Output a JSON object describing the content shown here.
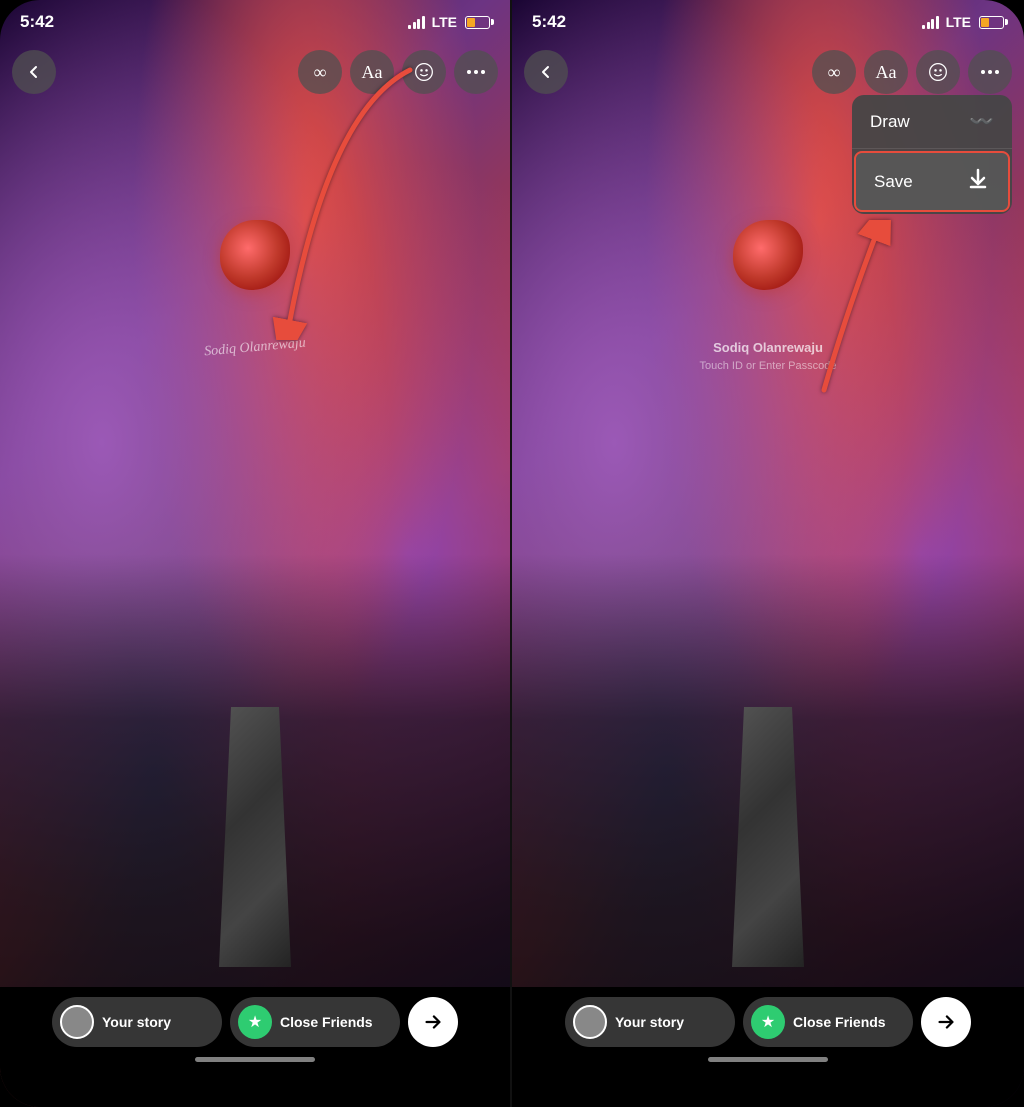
{
  "left_screen": {
    "time": "5:42",
    "lte": "LTE",
    "toolbar": {
      "back_label": "‹",
      "infinity_label": "∞",
      "text_label": "Aa",
      "sticker_label": "☺",
      "more_label": "•••"
    },
    "watermark": "Sodiq Olanrewaju",
    "bottom": {
      "your_story_label": "Your story",
      "close_friends_label": "Close Friends",
      "send_icon": "→"
    }
  },
  "right_screen": {
    "time": "5:42",
    "lte": "LTE",
    "toolbar": {
      "back_label": "‹",
      "infinity_label": "∞",
      "text_label": "Aa",
      "sticker_label": "☺",
      "more_label": "•••"
    },
    "watermark": "Sodiq Olanrewaju",
    "watermark_sub": "Touch ID or Enter Passcode",
    "dropdown": {
      "draw_label": "Draw",
      "draw_icon": "〰",
      "save_label": "Save",
      "save_icon": "⬇"
    },
    "bottom": {
      "your_story_label": "Your story",
      "close_friends_label": "Close Friends",
      "send_icon": "→"
    }
  }
}
